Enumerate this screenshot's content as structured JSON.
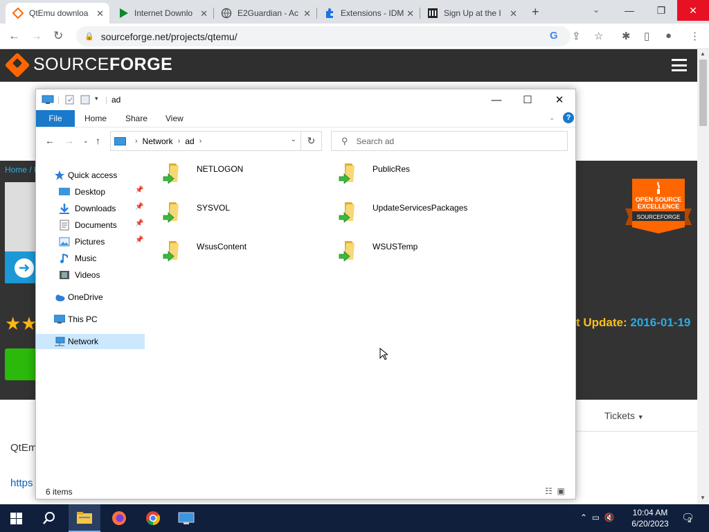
{
  "browser": {
    "tabs": [
      {
        "label": "QtEmu downloa",
        "active": true
      },
      {
        "label": "Internet Downlo",
        "active": false
      },
      {
        "label": "E2Guardian - Ac",
        "active": false
      },
      {
        "label": "Extensions - IDM",
        "active": false
      },
      {
        "label": "Sign Up at the I",
        "active": false
      }
    ],
    "new_tab": "+",
    "url": "sourceforge.net/projects/qtemu/"
  },
  "page": {
    "logo_light": "SOURCE",
    "logo_bold": "FORGE",
    "breadcrumb": "Home / E",
    "update_label": "t Update: ",
    "update_date": "2016-01-19",
    "badge_line1": "OPEN SOURCE",
    "badge_line2": "EXCELLENCE",
    "badge_line3": "SOURCEFORGE",
    "tickets": "Tickets",
    "desc_start": "QtEm",
    "link_start": "https"
  },
  "explorer": {
    "title": "ad",
    "ribbon": {
      "file": "File",
      "home": "Home",
      "share": "Share",
      "view": "View",
      "help": "?"
    },
    "address": {
      "root": "Network",
      "current": "ad"
    },
    "search_placeholder": "Search ad",
    "nav": {
      "quick_access": "Quick access",
      "desktop": "Desktop",
      "downloads": "Downloads",
      "documents": "Documents",
      "pictures": "Pictures",
      "music": "Music",
      "videos": "Videos",
      "onedrive": "OneDrive",
      "this_pc": "This PC",
      "network": "Network"
    },
    "items": [
      "NETLOGON",
      "PublicRes",
      "SYSVOL",
      "UpdateServicesPackages",
      "WsusContent",
      "WSUSTemp"
    ],
    "status": "6 items"
  },
  "taskbar": {
    "time": "10:04 AM",
    "date": "6/20/2023",
    "notifications": "2"
  },
  "colors": {
    "accent": "#1979ca",
    "sf_orange": "#ff6600",
    "close_red": "#e81123"
  }
}
